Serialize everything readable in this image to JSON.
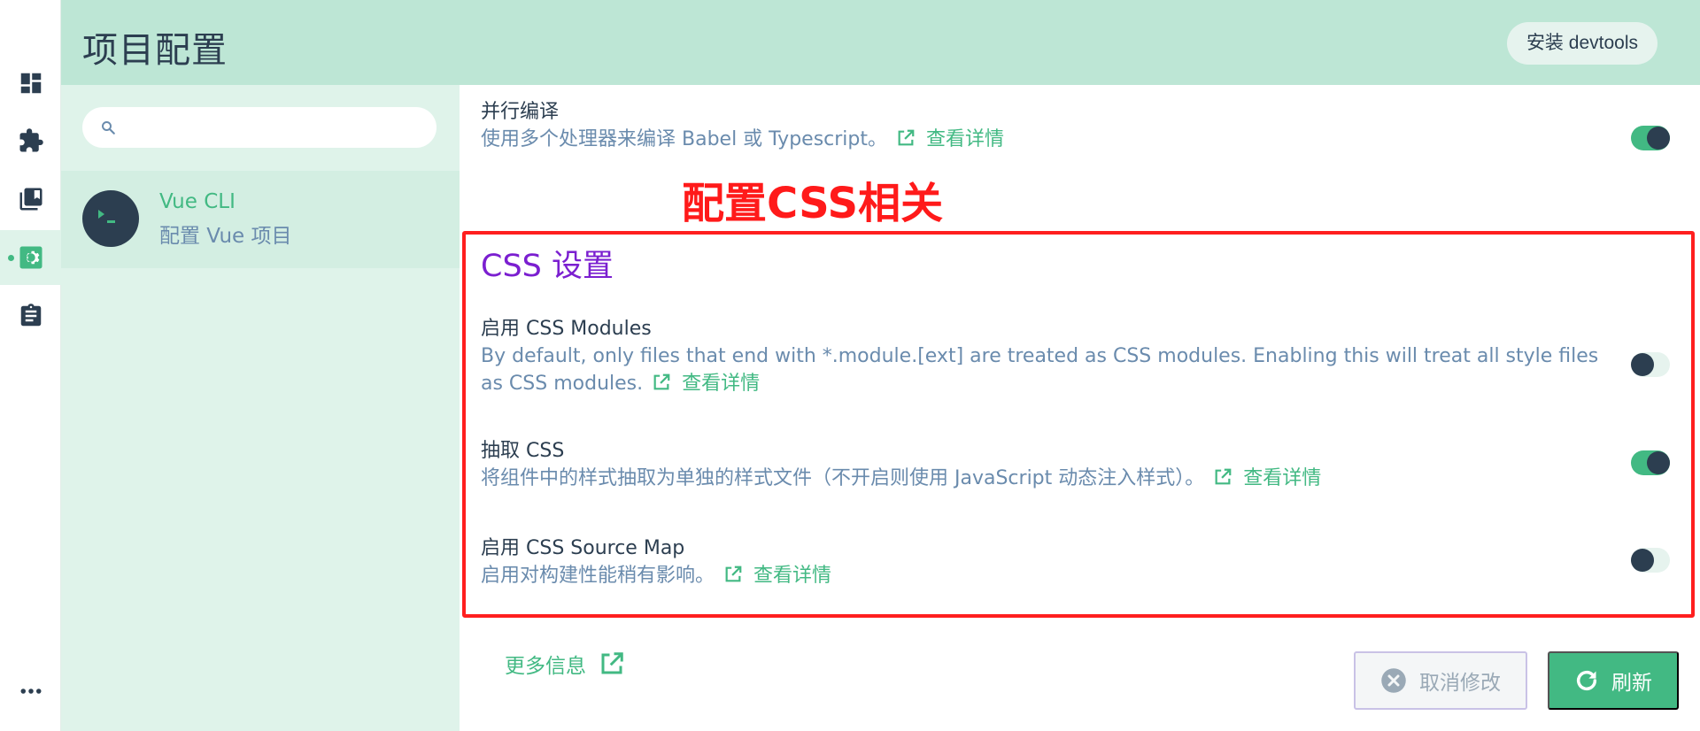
{
  "header": {
    "title": "项目配置",
    "devtools_label": "安装 devtools"
  },
  "rail": {
    "items": [
      "dashboard-icon",
      "plugins-icon",
      "dependencies-icon",
      "configuration-icon",
      "tasks-icon",
      "more-icon"
    ],
    "active": "configuration-icon"
  },
  "sidebar": {
    "search_placeholder": "",
    "project": {
      "name": "Vue CLI",
      "subtitle": "配置 Vue 项目"
    }
  },
  "content": {
    "parallel": {
      "title": "并行编译",
      "desc": "使用多个处理器来编译 Babel 或 Typescript。",
      "link": "查看详情",
      "enabled": true
    },
    "annotation": "配置CSS相关",
    "section_title": "CSS 设置",
    "settings": [
      {
        "title": "启用 CSS Modules",
        "desc": "By default, only files that end with *.module.[ext] are treated as CSS modules. Enabling this will treat all style files as CSS modules.",
        "link": "查看详情",
        "enabled": false
      },
      {
        "title": "抽取 CSS",
        "desc": "将组件中的样式抽取为单独的样式文件（不开启则使用 JavaScript 动态注入样式）。",
        "link": "查看详情",
        "enabled": true
      },
      {
        "title": "启用 CSS Source Map",
        "desc": "启用对构建性能稍有影响。",
        "link": "查看详情",
        "enabled": false
      }
    ]
  },
  "footer": {
    "more_info": "更多信息",
    "cancel_label": "取消修改",
    "refresh_label": "刷新"
  },
  "colors": {
    "accent": "#42b983",
    "header_bg": "#bde6d5",
    "sidebar_bg": "#dff3ea",
    "dark": "#2c3e50",
    "annotation_red": "#ff1f1f",
    "section_purple": "#7b1fd0"
  }
}
